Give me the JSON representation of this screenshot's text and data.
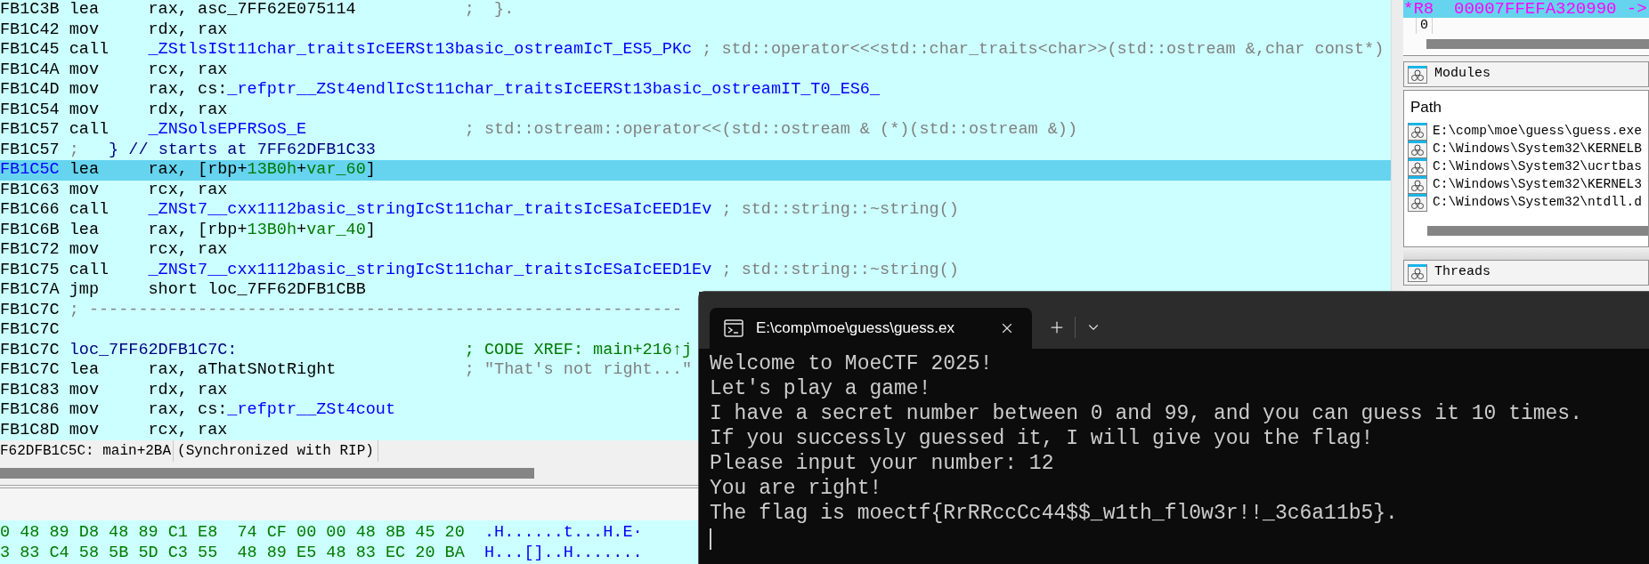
{
  "disassembly": {
    "rows": [
      {
        "kind": "instruction",
        "selected": false,
        "address": "FB1C3B",
        "mnemonic": "lea",
        "operands": [
          {
            "text": "rax, asc_7FF62E075114",
            "kind": "plain"
          }
        ],
        "comment": {
          "text": ";  }.",
          "kind": "comment"
        }
      },
      {
        "kind": "instruction",
        "selected": false,
        "address": "FB1C42",
        "mnemonic": "mov",
        "operands": [
          {
            "text": "rdx, rax",
            "kind": "plain"
          }
        ]
      },
      {
        "kind": "instruction",
        "selected": false,
        "address": "FB1C45",
        "mnemonic": "call",
        "operands": [
          {
            "text": "_ZStlsISt11char_traitsIcEERSt13basic_ostreamIcT_ES5_PKc",
            "kind": "name"
          }
        ],
        "comment": {
          "text": "; std::operator<<<std::char_traits<char>>(std::ostream &,char const*)",
          "kind": "comment"
        }
      },
      {
        "kind": "instruction",
        "selected": false,
        "address": "FB1C4A",
        "mnemonic": "mov",
        "operands": [
          {
            "text": "rcx, rax",
            "kind": "plain"
          }
        ]
      },
      {
        "kind": "instruction",
        "selected": false,
        "address": "FB1C4D",
        "mnemonic": "mov",
        "operands": [
          {
            "text": "rax, cs:",
            "kind": "plain"
          },
          {
            "text": "_refptr__ZSt4endlIcSt11char_traitsIcEERSt13basic_ostreamIT_T0_ES6_",
            "kind": "name"
          }
        ]
      },
      {
        "kind": "instruction",
        "selected": false,
        "address": "FB1C54",
        "mnemonic": "mov",
        "operands": [
          {
            "text": "rdx, rax",
            "kind": "plain"
          }
        ]
      },
      {
        "kind": "instruction",
        "selected": false,
        "address": "FB1C57",
        "mnemonic": "call",
        "operands": [
          {
            "text": "_ZNSolsEPFRSoS_E",
            "kind": "name"
          }
        ],
        "comment": {
          "text": "; std::ostream::operator<<(std::ostream & (*)(std::ostream &))",
          "kind": "comment"
        }
      },
      {
        "kind": "note",
        "selected": false,
        "address": "FB1C57",
        "parts": [
          {
            "text": ";",
            "kind": "comment"
          },
          {
            "text": "   } // starts at 7FF62DFB1C33",
            "kind": "label"
          }
        ]
      },
      {
        "kind": "instruction",
        "selected": true,
        "address": "FB1C5C",
        "mnemonic": "lea",
        "operands": [
          {
            "text": "rax, [rbp+",
            "kind": "plain"
          },
          {
            "text": "13B0h",
            "kind": "number"
          },
          {
            "text": "+",
            "kind": "plain"
          },
          {
            "text": "var_60",
            "kind": "number"
          },
          {
            "text": "]",
            "kind": "plain"
          }
        ]
      },
      {
        "kind": "instruction",
        "selected": false,
        "address": "FB1C63",
        "mnemonic": "mov",
        "operands": [
          {
            "text": "rcx, rax",
            "kind": "plain"
          }
        ]
      },
      {
        "kind": "instruction",
        "selected": false,
        "address": "FB1C66",
        "mnemonic": "call",
        "operands": [
          {
            "text": "_ZNSt7__cxx1112basic_stringIcSt11char_traitsIcESaIcEED1Ev",
            "kind": "name"
          }
        ],
        "comment": {
          "text": "; std::string::~string()",
          "kind": "comment"
        }
      },
      {
        "kind": "instruction",
        "selected": false,
        "address": "FB1C6B",
        "mnemonic": "lea",
        "operands": [
          {
            "text": "rax, [rbp+",
            "kind": "plain"
          },
          {
            "text": "13B0h",
            "kind": "number"
          },
          {
            "text": "+",
            "kind": "plain"
          },
          {
            "text": "var_40",
            "kind": "number"
          },
          {
            "text": "]",
            "kind": "plain"
          }
        ]
      },
      {
        "kind": "instruction",
        "selected": false,
        "address": "FB1C72",
        "mnemonic": "mov",
        "operands": [
          {
            "text": "rcx, rax",
            "kind": "plain"
          }
        ]
      },
      {
        "kind": "instruction",
        "selected": false,
        "address": "FB1C75",
        "mnemonic": "call",
        "operands": [
          {
            "text": "_ZNSt7__cxx1112basic_stringIcSt11char_traitsIcESaIcEED1Ev",
            "kind": "name"
          }
        ],
        "comment": {
          "text": "; std::string::~string()",
          "kind": "comment"
        }
      },
      {
        "kind": "instruction",
        "selected": false,
        "address": "FB1C7A",
        "mnemonic": "jmp",
        "operands": [
          {
            "text": "short loc_7FF62DFB1CBB",
            "kind": "plain"
          }
        ]
      },
      {
        "kind": "note",
        "selected": false,
        "address": "FB1C7C",
        "parts": [
          {
            "text": "; ------------------------------------------------------------",
            "kind": "comment"
          }
        ]
      },
      {
        "kind": "blank",
        "selected": false,
        "address": "FB1C7C"
      },
      {
        "kind": "label",
        "selected": false,
        "address": "FB1C7C",
        "label": "loc_7FF62DFB1C7C:",
        "comment": {
          "text": "; CODE XREF: main+216↑j",
          "kind": "xref"
        }
      },
      {
        "kind": "instruction",
        "selected": false,
        "address": "FB1C7C",
        "mnemonic": "lea",
        "operands": [
          {
            "text": "rax, aThatSNotRight",
            "kind": "plain"
          }
        ],
        "comment": {
          "text": "; \"That's not right...\"",
          "kind": "comment"
        }
      },
      {
        "kind": "instruction",
        "selected": false,
        "address": "FB1C83",
        "mnemonic": "mov",
        "operands": [
          {
            "text": "rdx, rax",
            "kind": "plain"
          }
        ]
      },
      {
        "kind": "instruction",
        "selected": false,
        "address": "FB1C86",
        "mnemonic": "mov",
        "operands": [
          {
            "text": "rax, cs:",
            "kind": "plain"
          },
          {
            "text": "_refptr__ZSt4cout",
            "kind": "name"
          }
        ]
      },
      {
        "kind": "instruction",
        "selected": false,
        "address": "FB1C8D",
        "mnemonic": "mov",
        "operands": [
          {
            "text": "rcx, rax",
            "kind": "plain"
          }
        ]
      }
    ],
    "status": {
      "location": "F62DFB1C5C: main+2BA",
      "sync": "(Synchronized with RIP)"
    }
  },
  "hex_dump": {
    "rows": [
      {
        "bytes": "0 48 89 D8 48 89 C1 E8  74 CF 00 00 48 8B 45 20",
        "ascii": ".H......t...H.E·"
      },
      {
        "bytes": "3 83 C4 58 5B 5D C3 55  48 89 E5 48 83 EC 20 BA",
        "ascii": "H...[]..H......."
      }
    ]
  },
  "registers": {
    "rows": [
      {
        "text": "*R8  00007FFEFA320990 ->",
        "selected": true
      }
    ],
    "cell": "0"
  },
  "modules": {
    "title": "Modules",
    "column": "Path",
    "items": [
      "E:\\comp\\moe\\guess\\guess.exe",
      "C:\\Windows\\System32\\KERNELB",
      "C:\\Windows\\System32\\ucrtbas",
      "C:\\Windows\\System32\\KERNEL3",
      "C:\\Windows\\System32\\ntdll.d"
    ]
  },
  "threads": {
    "title": "Threads"
  },
  "terminal": {
    "tab": {
      "title": "E:\\comp\\moe\\guess\\guess.ex",
      "selected": true
    },
    "lines": [
      "Welcome to MoeCTF 2025!",
      "Let's play a game!",
      "I have a secret number between 0 and 99, and you can guess it 10 times.",
      "If you successly guessed it, I will give you the flag!",
      "Please input your number: 12",
      "You are right!",
      "The flag is moectf{RrRRccCc44$$_w1th_fl0w3r!!_3c6a11b5}."
    ]
  }
}
